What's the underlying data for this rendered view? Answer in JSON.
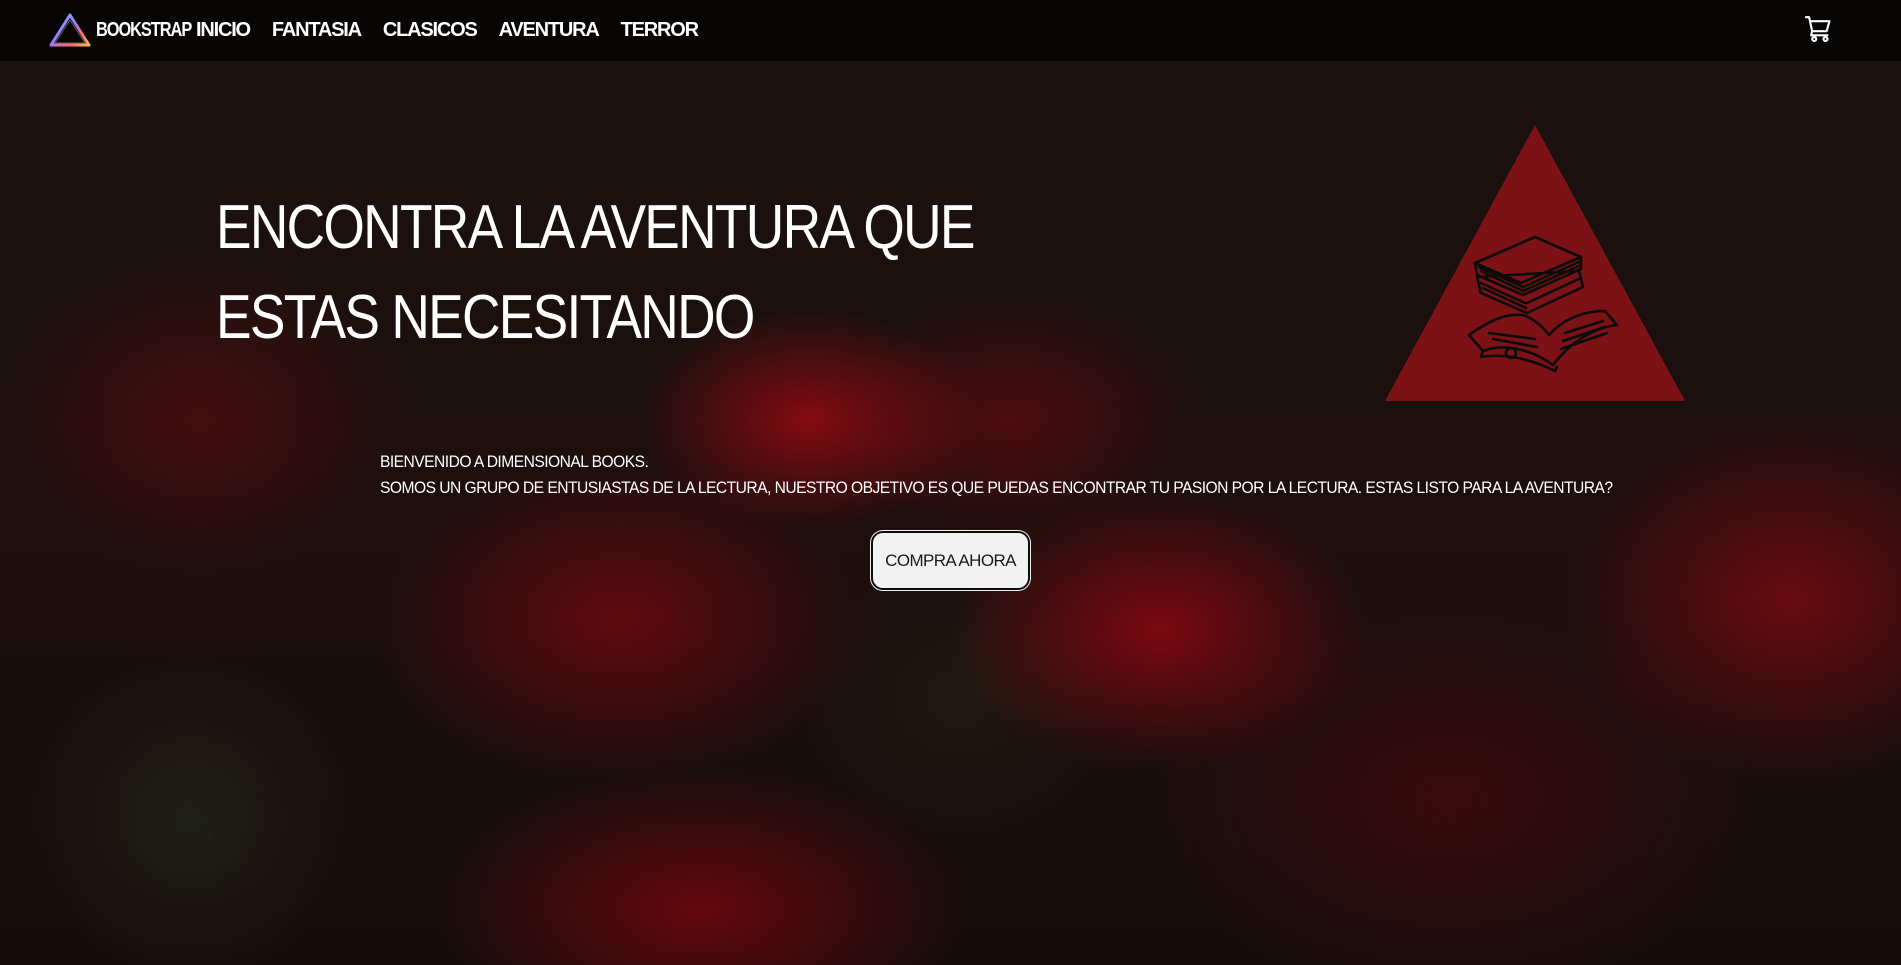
{
  "nav": {
    "brand_label": "BOOKSTRAP",
    "brand_icon": "prism-triangle-logo",
    "links": [
      {
        "label": "INICIO"
      },
      {
        "label": "FANTASIA"
      },
      {
        "label": "CLASICOS"
      },
      {
        "label": "AVENTURA"
      },
      {
        "label": "TERROR"
      }
    ],
    "cart_icon": "cart-icon"
  },
  "hero": {
    "title": "ENCONTRA LA AVENTURA QUE ESTAS NECESITANDO",
    "logo_icon": "books-triangle-logo",
    "intro_line_1": "BIENVENIDO A DIMENSIONAL BOOKS.",
    "intro_line_2": "SOMOS UN GRUPO DE ENTUSIASTAS DE LA LECTURA, NUESTRO OBJETIVO ES QUE PUEDAS ENCONTRAR TU PASION POR LA LECTURA. ESTAS LISTO PARA LA AVENTURA?",
    "cta_label": "COMPRA AHORA"
  },
  "colors": {
    "nav_bg": "#060404",
    "accent_red": "#7d1216",
    "button_bg": "#f2f2f2",
    "text": "#ffffff"
  }
}
